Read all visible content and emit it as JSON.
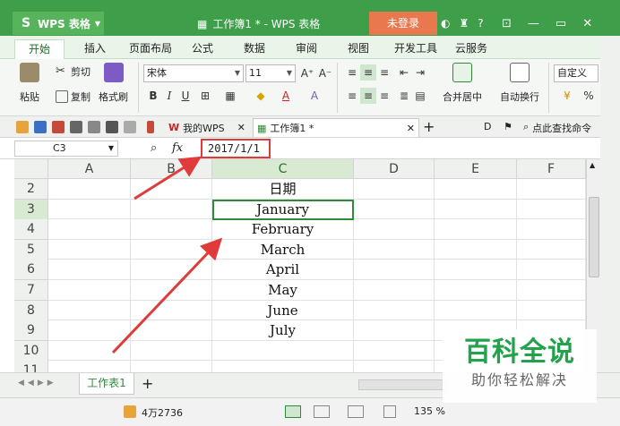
{
  "titlebar": {
    "app_name": "WPS 表格",
    "doc_title": "工作簿1 * - WPS 表格",
    "login_label": "未登录",
    "window_controls": [
      "minimize-icon",
      "restore-icon",
      "close-icon"
    ]
  },
  "menu": {
    "tabs": [
      "开始",
      "插入",
      "页面布局",
      "公式",
      "数据",
      "审阅",
      "视图",
      "开发工具",
      "云服务"
    ],
    "active": "开始"
  },
  "ribbon": {
    "paste_label": "粘贴",
    "cut_label": "剪切",
    "copy_label": "复制",
    "format_painter_label": "格式刷",
    "font_name": "宋体",
    "font_size": "11",
    "merge_center_label": "合并居中",
    "wrap_text_label": "自动换行",
    "number_format": "自定义",
    "percent_symbol": "%"
  },
  "doc_tabs": {
    "my_wps": "我的WPS",
    "current_doc": "工作簿1 *",
    "search_hint": "点此查找命令"
  },
  "formula_bar": {
    "cell_ref": "C3",
    "fx_label": "fx",
    "value": "2017/1/1"
  },
  "grid": {
    "columns": [
      "A",
      "B",
      "C",
      "D",
      "E",
      "F"
    ],
    "selected_column": "C",
    "rows": [
      "2",
      "3",
      "4",
      "5",
      "6",
      "7",
      "8",
      "9",
      "10",
      "11"
    ],
    "selected_row": "3",
    "column_c_values": [
      "日期",
      "January",
      "February",
      "March",
      "April",
      "May",
      "June",
      "July",
      "",
      ""
    ]
  },
  "sheet_bar": {
    "sheet_name": "工作表1",
    "add_label": "+"
  },
  "status_bar": {
    "count_text": "4万2736",
    "zoom_text": "135 %"
  },
  "watermark": {
    "title": "百科全说",
    "subtitle": "助你轻松解决"
  },
  "colors": {
    "title_green": "#3e9e4a",
    "login_orange": "#e9784f",
    "selection_green": "#2f8a3a",
    "annotation_red": "#e03b3b",
    "watermark_green": "#22a24a"
  }
}
